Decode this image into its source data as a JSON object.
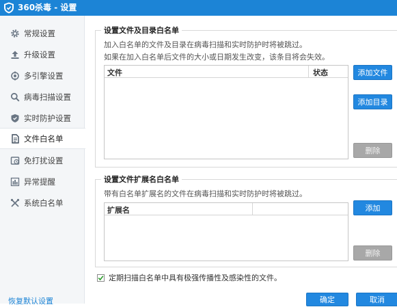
{
  "window": {
    "title": "360杀毒 - 设置",
    "accent": "#1c84d6"
  },
  "sidebar": {
    "items": [
      {
        "label": "常规设置",
        "icon": "gear-icon",
        "active": false
      },
      {
        "label": "升级设置",
        "icon": "upgrade-arrow-icon",
        "active": false
      },
      {
        "label": "多引擎设置",
        "icon": "engine-icon",
        "active": false
      },
      {
        "label": "病毒扫描设置",
        "icon": "search-icon",
        "active": false
      },
      {
        "label": "实时防护设置",
        "icon": "shield-icon",
        "active": false
      },
      {
        "label": "文件白名单",
        "icon": "document-icon",
        "active": true
      },
      {
        "label": "免打扰设置",
        "icon": "do-not-disturb-icon",
        "active": false
      },
      {
        "label": "异常提醒",
        "icon": "bar-chart-icon",
        "active": false
      },
      {
        "label": "系统白名单",
        "icon": "tools-icon",
        "active": false
      }
    ],
    "restore_label": "恢复默认设置"
  },
  "file_whitelist": {
    "title": "设置文件及目录白名单",
    "desc1": "加入白名单的文件及目录在病毒扫描和实时防护时将被跳过。",
    "desc2": "如果在加入白名单后文件的大小或日期发生改变，该条目将会失效。",
    "columns": [
      "文件",
      "状态"
    ],
    "add_file_label": "添加文件",
    "add_dir_label": "添加目录",
    "delete_label": "删除"
  },
  "ext_whitelist": {
    "title": "设置文件扩展名白名单",
    "desc": "带有白名单扩展名的文件在病毒扫描和实时防护时将被跳过。",
    "columns": [
      "扩展名",
      ""
    ],
    "add_label": "添加",
    "delete_label": "删除"
  },
  "periodic_scan": {
    "checked": true,
    "label": "定期扫描白名单中具有极强传播性及感染性的文件。"
  },
  "footer": {
    "ok_label": "确定",
    "cancel_label": "取消"
  }
}
